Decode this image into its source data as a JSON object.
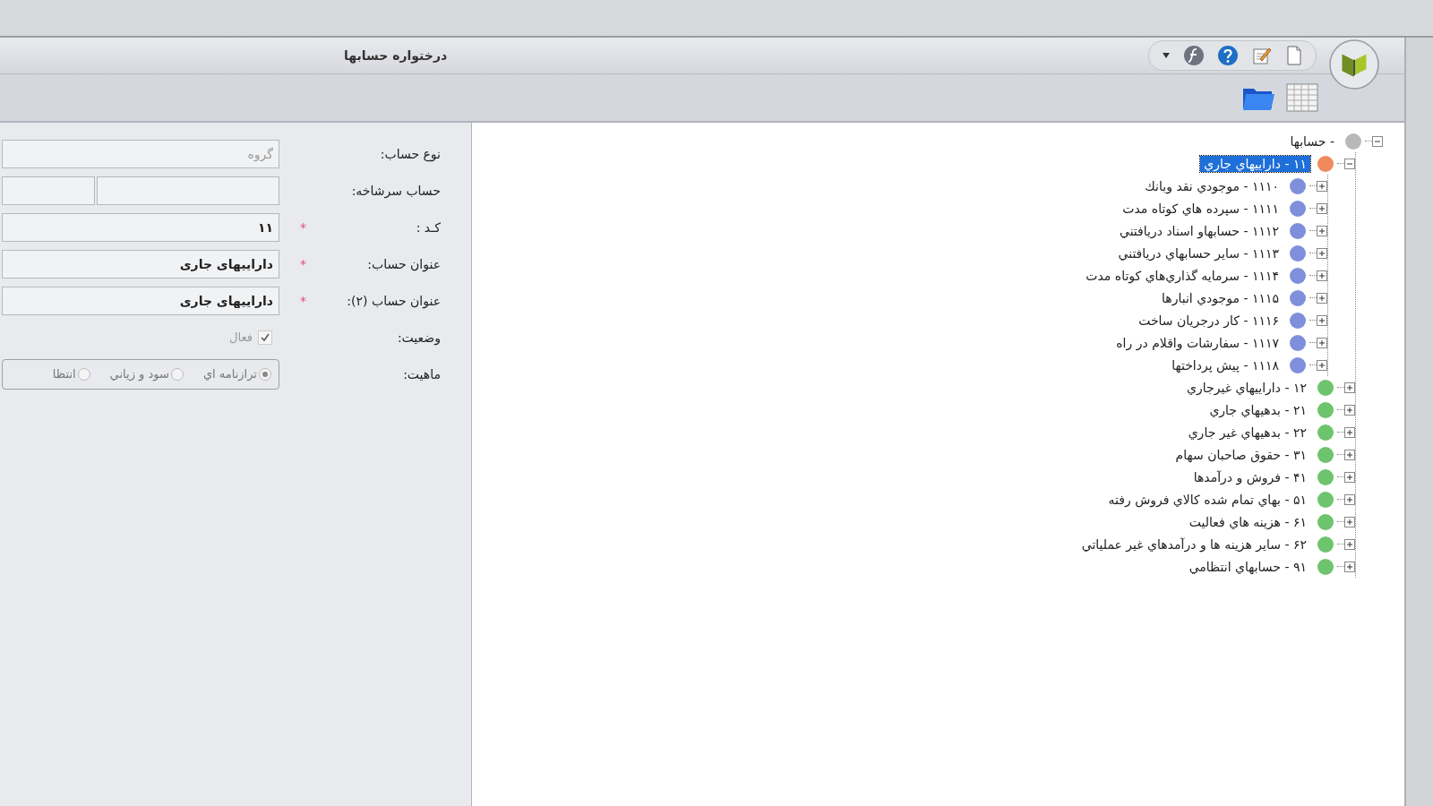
{
  "window": {
    "title": "درختواره حسابها"
  },
  "form": {
    "fields": [
      {
        "kind": "text",
        "label": "نوع حساب:",
        "placeholder": "گروه"
      },
      {
        "kind": "split",
        "label": "حساب سرشاخه:"
      },
      {
        "kind": "text",
        "label": "کـد :",
        "mark": "*",
        "value": "۱۱"
      },
      {
        "kind": "text",
        "label": "عنوان حساب:",
        "mark": "*",
        "value": "داراييهاي جاري"
      },
      {
        "kind": "text",
        "label": "عنوان حساب (۲):",
        "mark": "*",
        "value": "داراييهاي جاري"
      },
      {
        "kind": "checkbox",
        "label": "وضعیت:",
        "option": "فعال",
        "checked": true
      },
      {
        "kind": "radio",
        "label": "ماهیت:",
        "options": [
          {
            "label": "ترازنامه اي",
            "selected": true
          },
          {
            "label": "سود و زياني",
            "selected": false
          },
          {
            "label": "انتظا",
            "selected": false
          }
        ]
      }
    ]
  },
  "tree": {
    "nodes": [
      {
        "label": "- حسابها",
        "color": "#b8b8b8",
        "expanded": true,
        "selected": false,
        "children": [
          {
            "label": "۱۱ - داراييهاي جاري",
            "color": "#f08a5d",
            "expanded": true,
            "selected": true,
            "children": [
              {
                "label": "۱۱۱۰ - موجودي نقد وبانك",
                "color": "#7f8fdc",
                "expanded": false,
                "selected": false
              },
              {
                "label": "۱۱۱۱ - سپرده هاي كوتاه مدت",
                "color": "#7f8fdc",
                "expanded": false,
                "selected": false
              },
              {
                "label": "۱۱۱۲ - حسابهاو اسناد دريافتني",
                "color": "#7f8fdc",
                "expanded": false,
                "selected": false
              },
              {
                "label": "۱۱۱۳ - ساير حسابهاي دريافتني",
                "color": "#7f8fdc",
                "expanded": false,
                "selected": false
              },
              {
                "label": "۱۱۱۴ - سرمايه گذاري‌هاي كوتاه مدت",
                "color": "#7f8fdc",
                "expanded": false,
                "selected": false
              },
              {
                "label": "۱۱۱۵ - موجودي انبارها",
                "color": "#7f8fdc",
                "expanded": false,
                "selected": false
              },
              {
                "label": "۱۱۱۶ - كار درجريان ساخت",
                "color": "#7f8fdc",
                "expanded": false,
                "selected": false
              },
              {
                "label": "۱۱۱۷ - سفارشات واقلام در راه",
                "color": "#7f8fdc",
                "expanded": false,
                "selected": false
              },
              {
                "label": "۱۱۱۸ - پيش پرداختها",
                "color": "#7f8fdc",
                "expanded": false,
                "selected": false
              }
            ]
          },
          {
            "label": "۱۲ - داراييهاي غيرجاري",
            "color": "#6cc46c",
            "expanded": false,
            "selected": false
          },
          {
            "label": "۲۱ - بدهيهاي جاري",
            "color": "#6cc46c",
            "expanded": false,
            "selected": false
          },
          {
            "label": "۲۲ - بدهيهاي غير جاري",
            "color": "#6cc46c",
            "expanded": false,
            "selected": false
          },
          {
            "label": "۳۱ - حقوق صاحبان سهام",
            "color": "#6cc46c",
            "expanded": false,
            "selected": false
          },
          {
            "label": "۴۱ - فروش و درآمدها",
            "color": "#6cc46c",
            "expanded": false,
            "selected": false
          },
          {
            "label": "۵۱ - بهاي تمام شده كالاي فروش رفته",
            "color": "#6cc46c",
            "expanded": false,
            "selected": false
          },
          {
            "label": "۶۱ - هزينه هاي فعاليت",
            "color": "#6cc46c",
            "expanded": false,
            "selected": false
          },
          {
            "label": "۶۲ - ساير هزينه ها و درآمدهاي غير عملياتي",
            "color": "#6cc46c",
            "expanded": false,
            "selected": false
          },
          {
            "label": "۹۱ - حسابهاي انتظامي",
            "color": "#6cc46c",
            "expanded": false,
            "selected": false
          }
        ]
      }
    ]
  }
}
